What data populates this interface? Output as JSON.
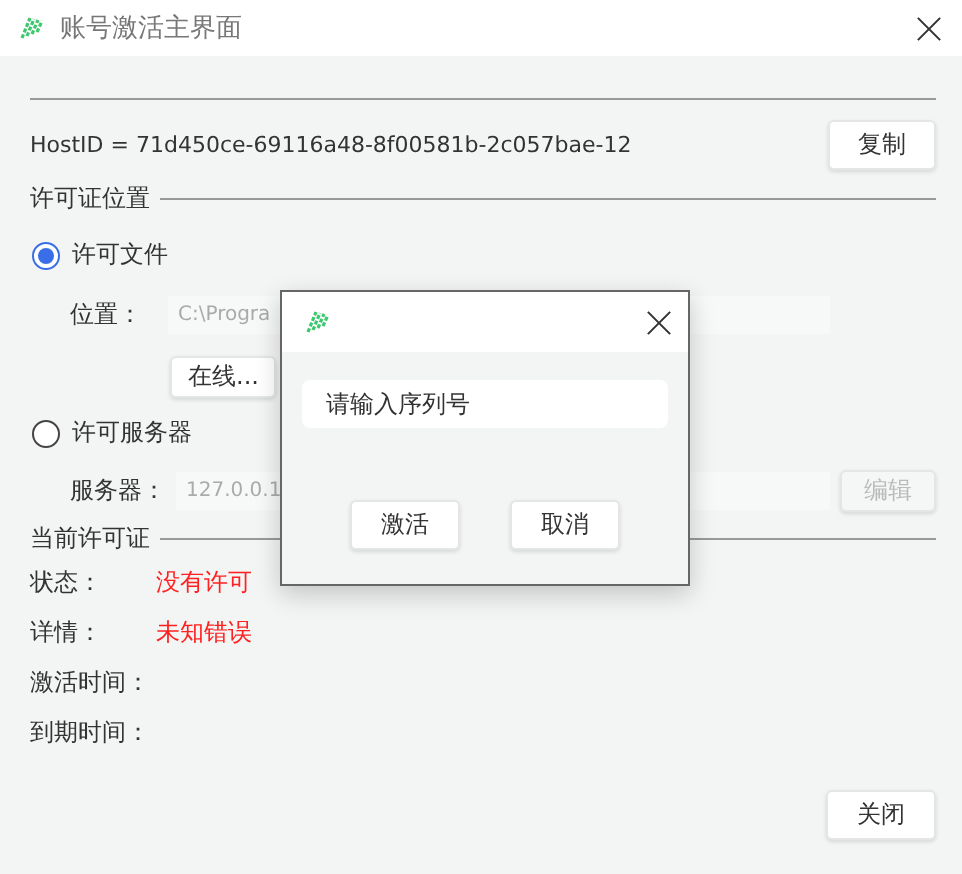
{
  "window": {
    "title": "账号激活主界面"
  },
  "host": {
    "text": "HostID = 71d450ce-69116a48-8f00581b-2c057bae-12",
    "copy_button": "复制"
  },
  "license_location": {
    "legend": "许可证位置",
    "options": [
      {
        "label": "许可文件",
        "selected": true
      },
      {
        "label": "许可服务器",
        "selected": false
      }
    ],
    "file_label": "位置：",
    "file_value": "C:\\Progra",
    "online_button": "在线...",
    "server_label": "服务器：",
    "server_value": "127.0.0.1",
    "edit_button": {
      "label": "编辑",
      "disabled": true
    }
  },
  "current_license": {
    "legend": "当前许可证",
    "rows": [
      {
        "label": "状态：",
        "value": "没有许可",
        "color": "#ff2020"
      },
      {
        "label": "详情：",
        "value": "未知错误",
        "color": "#ff2020"
      },
      {
        "label": "激活时间："
      },
      {
        "label": "到期时间："
      }
    ]
  },
  "close_button": "关闭",
  "dialog": {
    "placeholder": "请输入序列号",
    "buttons": [
      "激活",
      "取消"
    ]
  }
}
